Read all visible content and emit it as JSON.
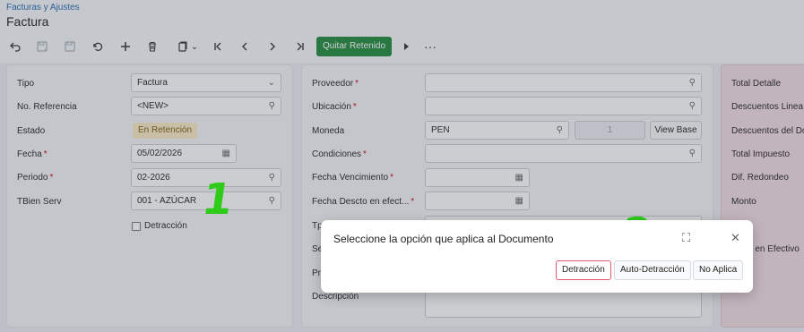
{
  "header": {
    "breadcrumb": "Facturas y Ajustes",
    "title": "Factura"
  },
  "toolbar": {
    "icons": [
      "undo-icon",
      "save-icon",
      "save-close-icon",
      "revert-icon",
      "add-icon",
      "delete-icon",
      "copy-icon",
      "first-icon",
      "prev-icon",
      "next-icon",
      "last-icon",
      "play-icon",
      "more-icon"
    ],
    "quitar_retenido": "Quitar Retenido",
    "copy_chevron": "⌄",
    "more": "···"
  },
  "left_panel": {
    "tipo_label": "Tipo",
    "tipo_value": "Factura",
    "noref_label": "No. Referencia",
    "noref_value": "<NEW>",
    "estado_label": "Estado",
    "estado_value": "En Retención",
    "fecha_label": "Fecha",
    "fecha_value": "05/02/2026",
    "periodo_label": "Periodo",
    "periodo_value": "02-2026",
    "tbien_label": "TBien Serv",
    "tbien_value": "001 - AZÚCAR",
    "detraccion_label": "Detracción",
    "required_mark": "*"
  },
  "middle_panel": {
    "proveedor_label": "Proveedor",
    "ubicacion_label": "Ubicación",
    "moneda_label": "Moneda",
    "moneda_value": "PEN",
    "rate_value": "1",
    "view_base": "View Base",
    "condiciones_label": "Condiciones",
    "fecha_venc_label": "Fecha Vencimiento",
    "fecha_desc_label": "Fecha Descto en efect...",
    "partial_tp": "Tp",
    "partial_se": "Se",
    "partial_pr": "Pr",
    "descripcion_label": "Descripción"
  },
  "right_panel": {
    "total_detalle": "Total Detalle",
    "desc_linea": "Descuentos Linea",
    "desc_do": "Descuentos del Do",
    "total_impuesto": "Total Impuesto",
    "dif_redondeo": "Dif. Redondeo",
    "monto": "Monto",
    "o_en_efectivo": "o en Efectivo"
  },
  "annotations": {
    "one": "1",
    "two": "2"
  },
  "modal": {
    "title": "Seleccione la opción que aplica al Documento",
    "btn_detraccion": "Detracción",
    "btn_auto": "Auto-Detracción",
    "btn_no_aplica": "No Aplica",
    "expand_icon": "⛶",
    "close_icon": "✕"
  },
  "colors": {
    "accent_green": "#1f8a3b",
    "badge_bg": "#fbecc5",
    "right_panel_bg": "#f3dde2",
    "marker": "#2ecc18"
  }
}
